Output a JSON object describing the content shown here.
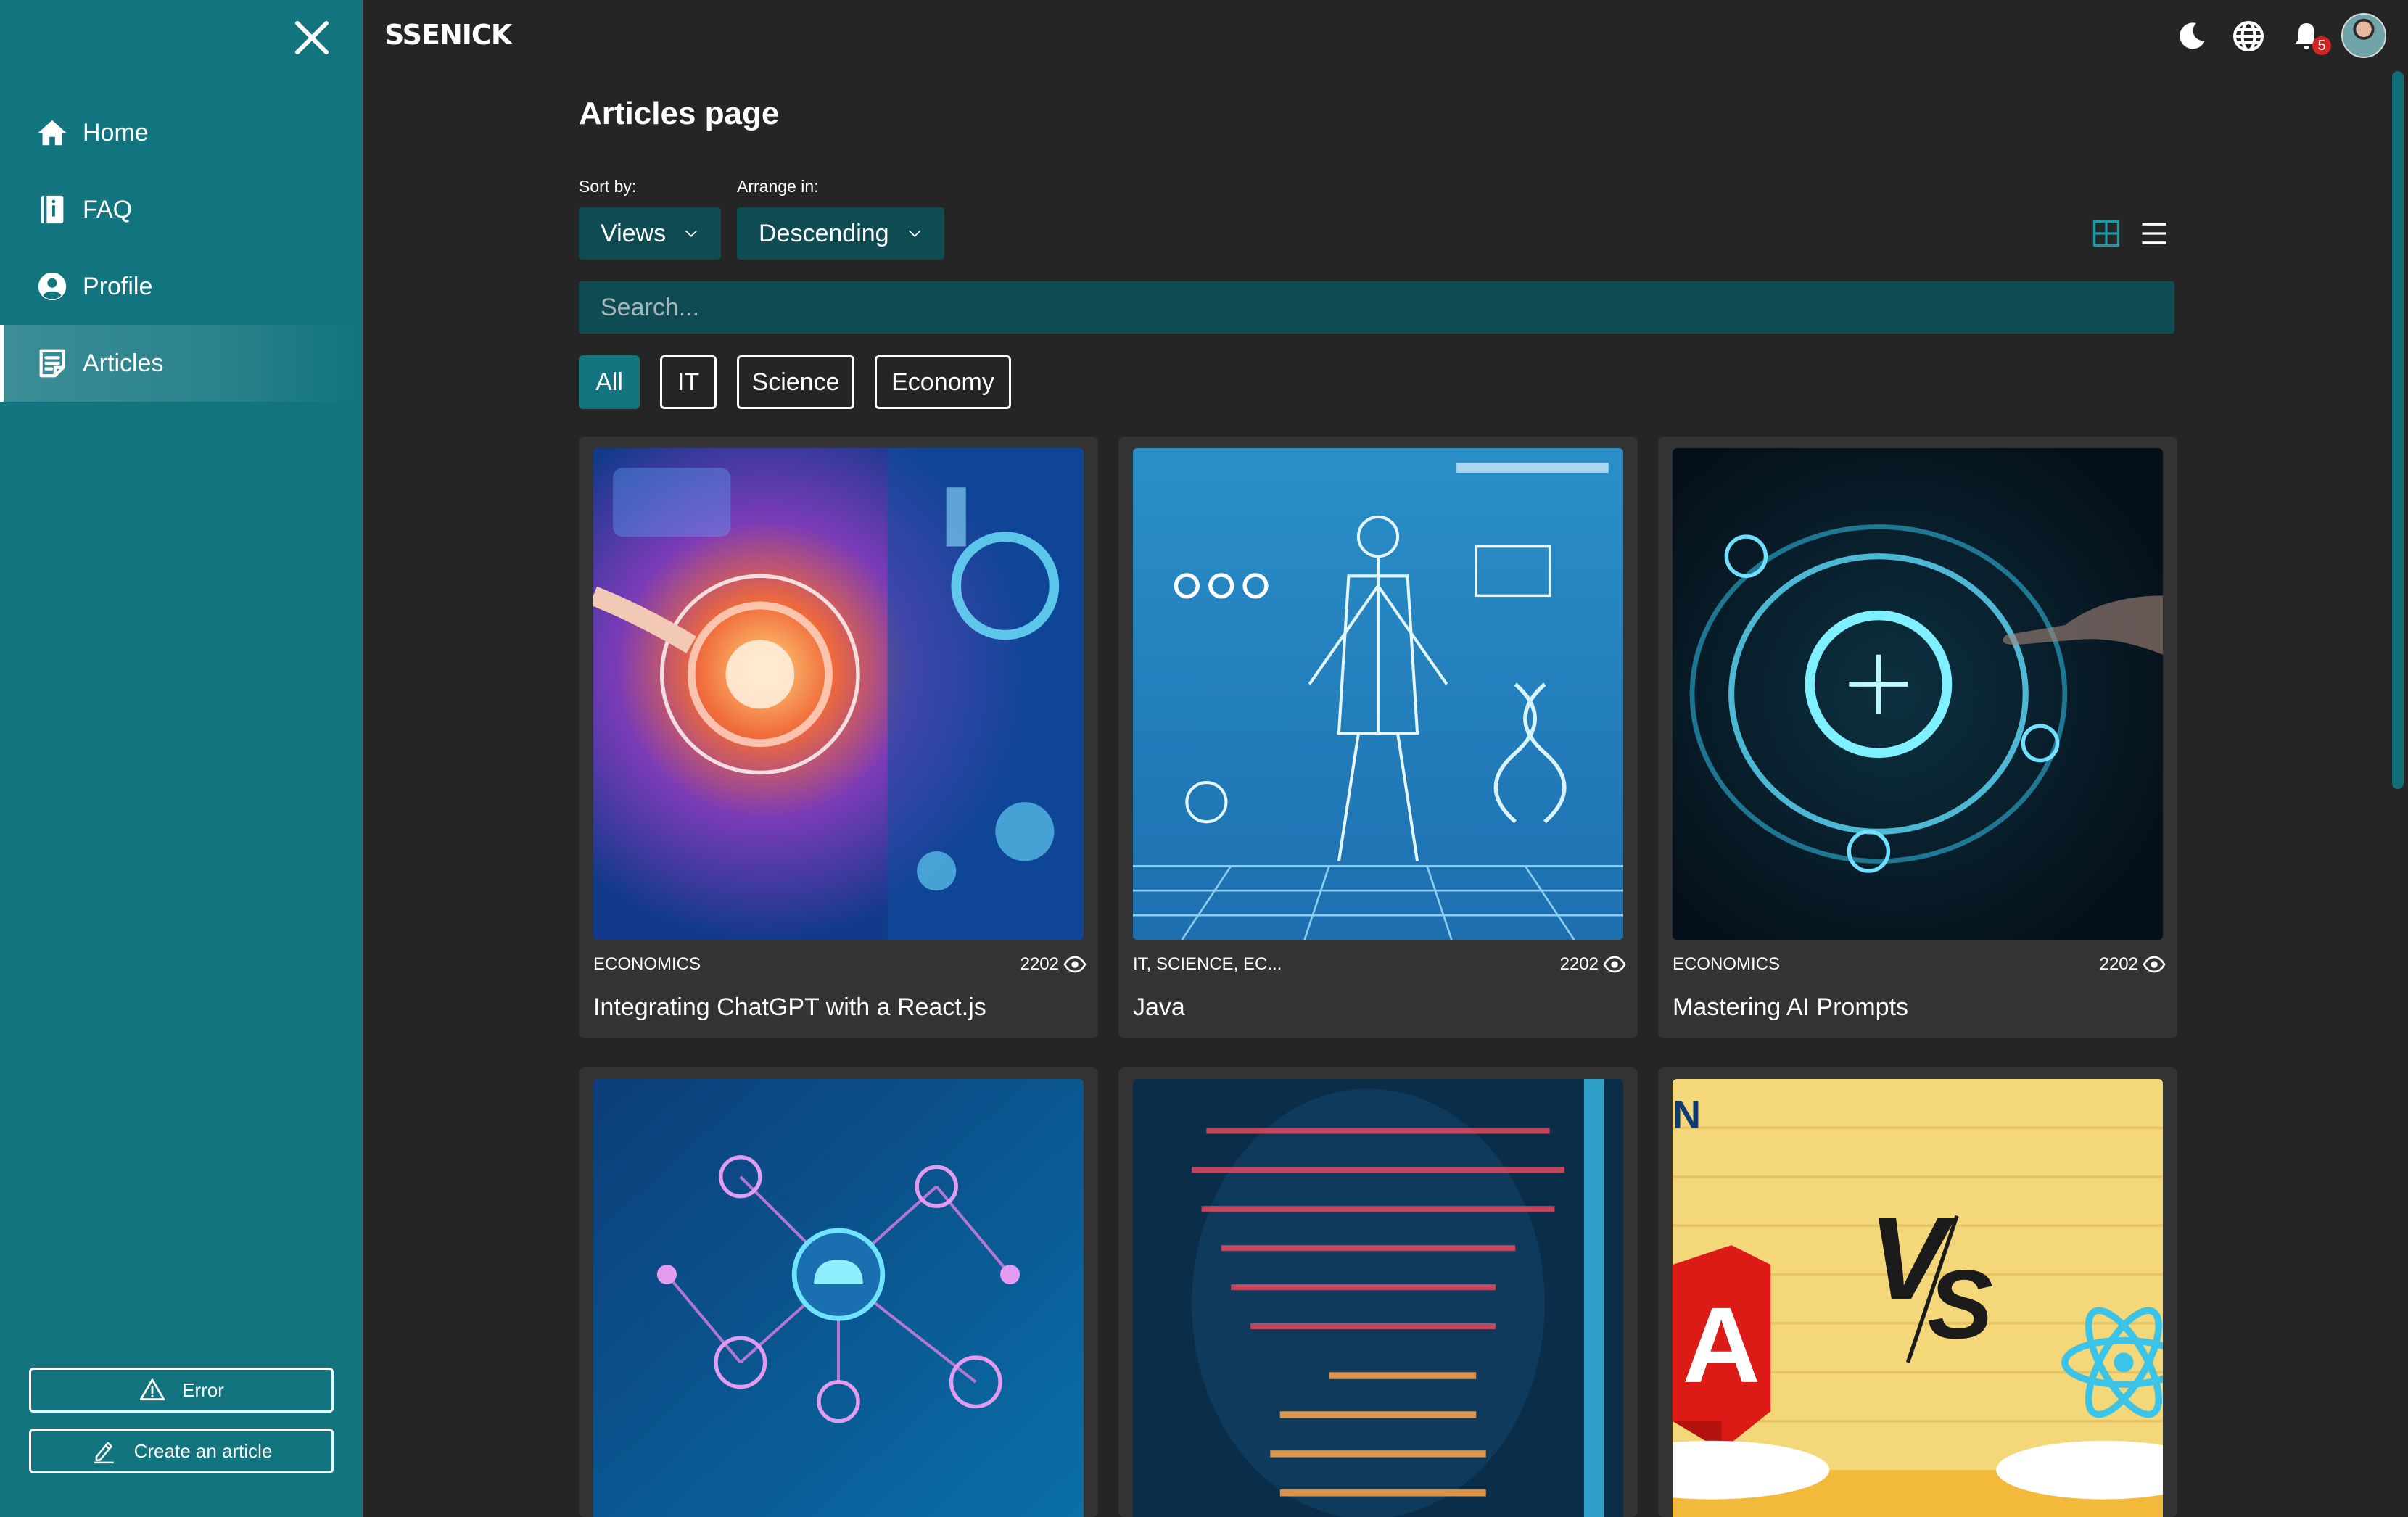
{
  "app": {
    "logo": "SSENICK"
  },
  "sidebar": {
    "items": [
      {
        "label": "Home",
        "icon": "home-icon"
      },
      {
        "label": "FAQ",
        "icon": "faq-icon"
      },
      {
        "label": "Profile",
        "icon": "profile-icon"
      },
      {
        "label": "Articles",
        "icon": "articles-icon",
        "active": true
      }
    ],
    "error_button": "Error",
    "create_button": "Create an article"
  },
  "header": {
    "notifications_count": "5"
  },
  "main": {
    "title": "Articles page",
    "sort": {
      "label": "Sort by:",
      "value": "Views"
    },
    "order": {
      "label": "Arrange in:",
      "value": "Descending"
    },
    "search": {
      "placeholder": "Search..."
    },
    "tabs": [
      {
        "label": "All",
        "active": true
      },
      {
        "label": "IT"
      },
      {
        "label": "Science"
      },
      {
        "label": "Economy"
      }
    ],
    "articles": [
      {
        "types": "ECONOMICS",
        "views": "2202",
        "title": "Integrating ChatGPT with a React.js"
      },
      {
        "types": "IT, SCIENCE, EC...",
        "views": "2202",
        "title": "Java"
      },
      {
        "types": "ECONOMICS",
        "views": "2202",
        "title": "Mastering AI Prompts"
      },
      {
        "types": "",
        "views": "",
        "title": ""
      },
      {
        "types": "",
        "views": "",
        "title": ""
      },
      {
        "types": "",
        "views": "",
        "title": ""
      }
    ]
  },
  "colors": {
    "sidebar": "#11747f",
    "background": "#252525",
    "input": "#0e4b53",
    "card": "#333333",
    "badge": "#d32424"
  }
}
